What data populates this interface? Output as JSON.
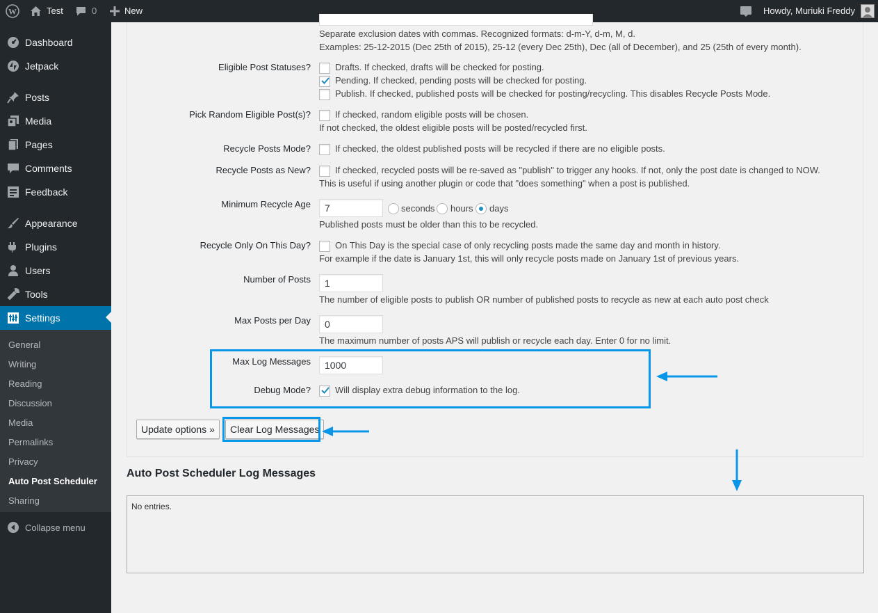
{
  "adminbar": {
    "site_name": "Test",
    "comments_count": "0",
    "new_label": "New",
    "greeting": "Howdy, Muriuki Freddy"
  },
  "menu": {
    "items": [
      {
        "label": "Dashboard",
        "icon": "dashboard-icon"
      },
      {
        "label": "Jetpack",
        "icon": "jetpack-icon"
      },
      {
        "label": "Posts",
        "icon": "pin-icon"
      },
      {
        "label": "Media",
        "icon": "media-icon"
      },
      {
        "label": "Pages",
        "icon": "pages-icon"
      },
      {
        "label": "Comments",
        "icon": "comments-icon"
      },
      {
        "label": "Feedback",
        "icon": "feedback-icon"
      },
      {
        "label": "Appearance",
        "icon": "brush-icon"
      },
      {
        "label": "Plugins",
        "icon": "plugin-icon"
      },
      {
        "label": "Users",
        "icon": "users-icon"
      },
      {
        "label": "Tools",
        "icon": "wrench-icon"
      },
      {
        "label": "Settings",
        "icon": "settings-icon"
      }
    ],
    "submenu": [
      "General",
      "Writing",
      "Reading",
      "Discussion",
      "Media",
      "Permalinks",
      "Privacy",
      "Auto Post Scheduler",
      "Sharing"
    ],
    "active_submenu": "Auto Post Scheduler",
    "collapse_label": "Collapse menu"
  },
  "exclusion": {
    "help1": "Separate exclusion dates with commas. Recognized formats: d-m-Y, d-m, M, d.",
    "help2": "Examples: 25-12-2015 (Dec 25th of 2015), 25-12 (every Dec 25th), Dec (all of December), and 25 (25th of every month)."
  },
  "statuses": {
    "label": "Eligible Post Statuses?",
    "drafts": "Drafts. If checked, drafts will be checked for posting.",
    "pending": "Pending. If checked, pending posts will be checked for posting.",
    "publish": "Publish. If checked, published posts will be checked for posting/recycling. This disables Recycle Posts Mode.",
    "drafts_checked": false,
    "pending_checked": true,
    "publish_checked": false
  },
  "random": {
    "label": "Pick Random Eligible Post(s)?",
    "text": "If checked, random eligible posts will be chosen.",
    "help": "If not checked, the oldest eligible posts will be posted/recycled first."
  },
  "recycle_mode": {
    "label": "Recycle Posts Mode?",
    "text": "If checked, the oldest published posts will be recycled if there are no eligible posts."
  },
  "recycle_new": {
    "label": "Recycle Posts as New?",
    "text": "If checked, recycled posts will be re-saved as \"publish\" to trigger any hooks. If not, only the post date is changed to NOW.",
    "help": "This is useful if using another plugin or code that \"does something\" when a post is published."
  },
  "min_age": {
    "label": "Minimum Recycle Age",
    "value": "7",
    "unit_seconds": "seconds",
    "unit_hours": "hours",
    "unit_days": "days",
    "selected_unit": "days",
    "help": "Published posts must be older than this to be recycled."
  },
  "on_this_day": {
    "label": "Recycle Only On This Day?",
    "text": "On This Day is the special case of only recycling posts made the same day and month in history.",
    "help": "For example if the date is January 1st, this will only recycle posts made on January 1st of previous years."
  },
  "num_posts": {
    "label": "Number of Posts",
    "value": "1",
    "help": "The number of eligible posts to publish OR number of published posts to recycle as new at each auto post check"
  },
  "max_per_day": {
    "label": "Max Posts per Day",
    "value": "0",
    "help": "The maximum number of posts APS will publish or recycle each day. Enter 0 for no limit."
  },
  "max_log": {
    "label": "Max Log Messages",
    "value": "1000"
  },
  "debug": {
    "label": "Debug Mode?",
    "text": "Will display extra debug information to the log.",
    "checked": true
  },
  "buttons": {
    "update": "Update options »",
    "clear_log": "Clear Log Messages"
  },
  "log": {
    "title": "Auto Post Scheduler Log Messages",
    "empty": "No entries."
  },
  "colors": {
    "highlight": "#0a96e8",
    "menu_bg": "#23282d",
    "menu_current": "#0073aa"
  }
}
